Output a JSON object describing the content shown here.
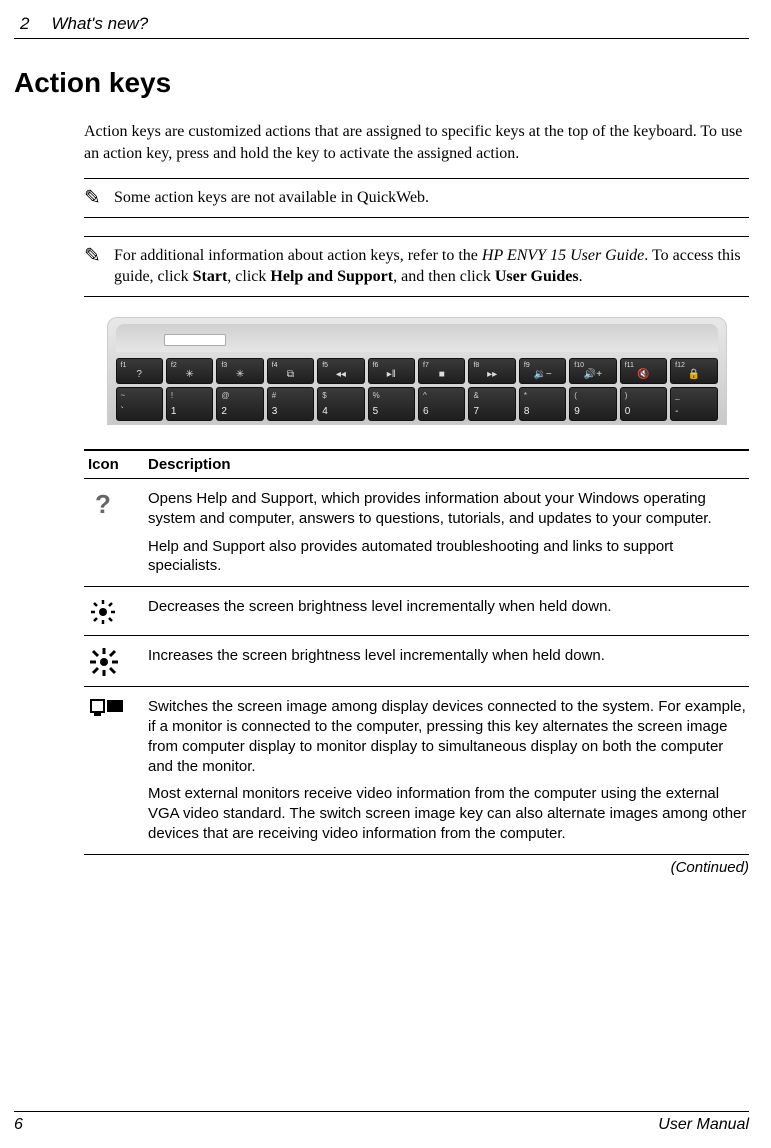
{
  "header": {
    "page_top_number": "2",
    "section_title": "What's new?"
  },
  "heading": "Action keys",
  "intro": "Action keys are customized actions that are assigned to specific keys at the top of the keyboard. To use an action key, press and hold the key to activate the assigned action.",
  "note1": "Some action keys are not available in QuickWeb.",
  "note2_pre": "For additional information about action keys, refer to the ",
  "note2_italic": "HP ENVY 15 User Guide",
  "note2_mid": ". To access this guide, click ",
  "note2_b1": "Start",
  "note2_s1": ", click ",
  "note2_b2": "Help and Support",
  "note2_s2": ", and then click ",
  "note2_b3": "User Guides",
  "note2_end": ".",
  "keyboard": {
    "frow": [
      {
        "label": "f1",
        "sym": "?"
      },
      {
        "label": "f2",
        "sym": "✳"
      },
      {
        "label": "f3",
        "sym": "✳"
      },
      {
        "label": "f4",
        "sym": "⧉"
      },
      {
        "label": "f5",
        "sym": "◂◂"
      },
      {
        "label": "f6",
        "sym": "▸‖"
      },
      {
        "label": "f7",
        "sym": "■"
      },
      {
        "label": "f8",
        "sym": "▸▸"
      },
      {
        "label": "f9",
        "sym": "🔉−"
      },
      {
        "label": "f10",
        "sym": "🔊+"
      },
      {
        "label": "f11",
        "sym": "🔇"
      },
      {
        "label": "f12",
        "sym": "🔒"
      }
    ],
    "nrow": [
      {
        "top": "~",
        "bot": "`"
      },
      {
        "top": "!",
        "bot": "1"
      },
      {
        "top": "@",
        "bot": "2"
      },
      {
        "top": "#",
        "bot": "3"
      },
      {
        "top": "$",
        "bot": "4"
      },
      {
        "top": "%",
        "bot": "5"
      },
      {
        "top": "^",
        "bot": "6"
      },
      {
        "top": "&",
        "bot": "7"
      },
      {
        "top": "*",
        "bot": "8"
      },
      {
        "top": "(",
        "bot": "9"
      },
      {
        "top": ")",
        "bot": "0"
      },
      {
        "top": "_",
        "bot": "-"
      }
    ]
  },
  "table": {
    "head_icon": "Icon",
    "head_desc": "Description",
    "rows": [
      {
        "p1": "Opens Help and Support, which provides information about your Windows operating system and computer, answers to questions, tutorials, and updates to your computer.",
        "p2": "Help and Support also provides automated troubleshooting and links to support specialists."
      },
      {
        "p1": "Decreases the screen brightness level incrementally when held down."
      },
      {
        "p1": "Increases the screen brightness level incrementally when held down."
      },
      {
        "p1": "Switches the screen image among display devices connected to the system. For example, if a monitor is connected to the computer, pressing this key alternates the screen image from computer display to monitor display to simultaneous display on both the computer and the monitor.",
        "p2": "Most external monitors receive video information from the computer using the external VGA video standard. The switch screen image key can also alternate images among other devices that are receiving video information from the computer."
      }
    ],
    "continued": "(Continued)"
  },
  "footer": {
    "page_bottom_number": "6",
    "doc_title": "User Manual"
  }
}
